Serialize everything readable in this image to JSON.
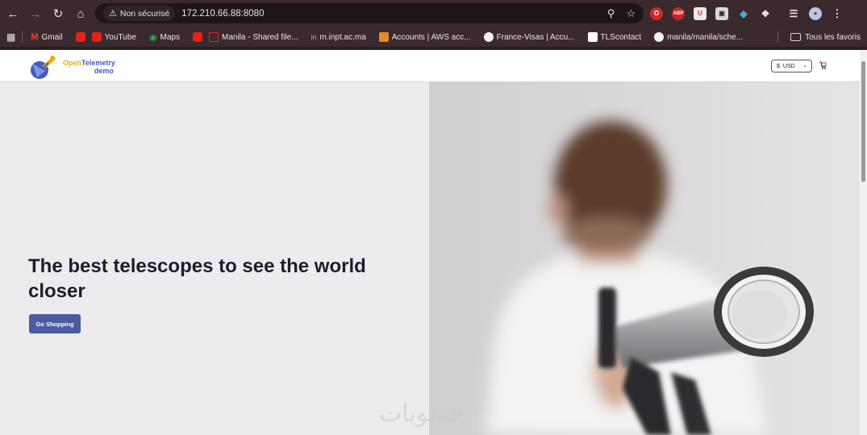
{
  "browser": {
    "security_label": "Non sécurisé",
    "url": "172.210.66.88:8080",
    "bookmarks": [
      {
        "label": "Gmail"
      },
      {
        "label": "YouTube"
      },
      {
        "label": "Maps"
      },
      {
        "label": ""
      },
      {
        "label": "Manila - Shared file..."
      },
      {
        "label": "m.inpt.ac.ma"
      },
      {
        "label": "Accounts | AWS acc..."
      },
      {
        "label": "France-Visas | Accu..."
      },
      {
        "label": "TLScontact"
      },
      {
        "label": "manila/manila/sche..."
      }
    ],
    "all_bookmarks_label": "Tous les favoris"
  },
  "site": {
    "brand_open": "Open",
    "brand_telemetry": "Telemetry",
    "brand_demo": "demo",
    "currency_symbol": "$",
    "currency_code": "USD"
  },
  "hero": {
    "title": "The best telescopes to see the world closer",
    "cta_label": "Go Shopping"
  },
  "colors": {
    "accent": "#4c5aa1",
    "brand_orange": "#f5a800",
    "brand_blue": "#425cc7",
    "chrome": "#3a2a2e"
  }
}
